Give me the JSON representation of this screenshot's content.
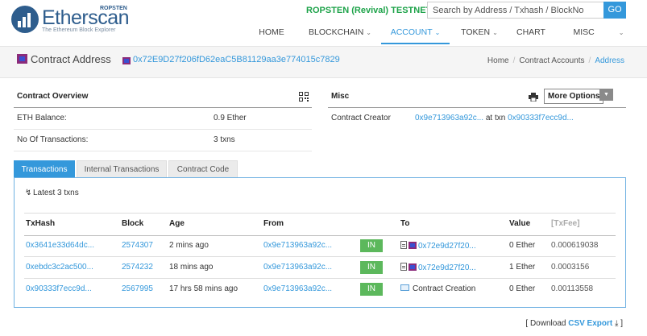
{
  "header": {
    "logo_title": "Etherscan",
    "logo_sup": "ROPSTEN",
    "logo_sub": "The Ethereum Block Explorer",
    "network": "ROPSTEN (Revival) TESTNET",
    "search_placeholder": "Search by Address / Txhash / BlockNo",
    "go_label": "GO",
    "nav": [
      {
        "label": "HOME",
        "chevron": false,
        "active": false
      },
      {
        "label": "BLOCKCHAIN",
        "chevron": true,
        "active": false
      },
      {
        "label": "ACCOUNT",
        "chevron": true,
        "active": true
      },
      {
        "label": "TOKEN",
        "chevron": true,
        "active": false
      },
      {
        "label": "CHART",
        "chevron": false,
        "active": false
      },
      {
        "label": "MISC",
        "chevron": true,
        "active": false
      }
    ]
  },
  "titlebar": {
    "title": "Contract Address",
    "address": "0x72E9D27f206fD62eaC5B81129aa3e774015c7829",
    "breadcrumb": [
      "Home",
      "Contract Accounts",
      "Address"
    ]
  },
  "overview": {
    "heading": "Contract Overview",
    "rows": [
      {
        "label": "ETH Balance:",
        "value": "0.9 Ether"
      },
      {
        "label": "No Of Transactions:",
        "value": "3 txns"
      }
    ]
  },
  "misc": {
    "heading": "Misc",
    "more_options": "More Options",
    "creator_label": "Contract Creator",
    "creator_address": "0x9e713963a92c...",
    "at_txn": "at txn",
    "creator_txn": "0x90333f7ecc9d..."
  },
  "tabs": [
    "Transactions",
    "Internal Transactions",
    "Contract Code"
  ],
  "transactions": {
    "latest": "Latest 3 txns",
    "columns": [
      "TxHash",
      "Block",
      "Age",
      "From",
      "To",
      "Value",
      "[TxFee]"
    ],
    "rows": [
      {
        "hash": "0x3641e33d64dc...",
        "block": "2574307",
        "age": "2 mins ago",
        "from": "0x9e713963a92c...",
        "dir": "IN",
        "to": "0x72e9d27f20...",
        "to_type": "contract",
        "value": "0 Ether",
        "fee": "0.000619038"
      },
      {
        "hash": "0xebdc3c2ac500...",
        "block": "2574232",
        "age": "18 mins ago",
        "from": "0x9e713963a92c...",
        "dir": "IN",
        "to": "0x72e9d27f20...",
        "to_type": "contract",
        "value": "1 Ether",
        "fee": "0.0003156"
      },
      {
        "hash": "0x90333f7ecc9d...",
        "block": "2567995",
        "age": "17 hrs 58 mins ago",
        "from": "0x9e713963a92c...",
        "dir": "IN",
        "to": "Contract Creation",
        "to_type": "creation",
        "value": "0 Ether",
        "fee": "0.00113558"
      }
    ]
  },
  "footer": {
    "download_prefix": "[ Download",
    "csv_label": "CSV Export",
    "download_suffix": "]"
  },
  "colors": {
    "accent": "#3498db",
    "brand": "#2e5d8d",
    "testnet": "#1ea34a",
    "in_badge": "#5cb85c"
  }
}
